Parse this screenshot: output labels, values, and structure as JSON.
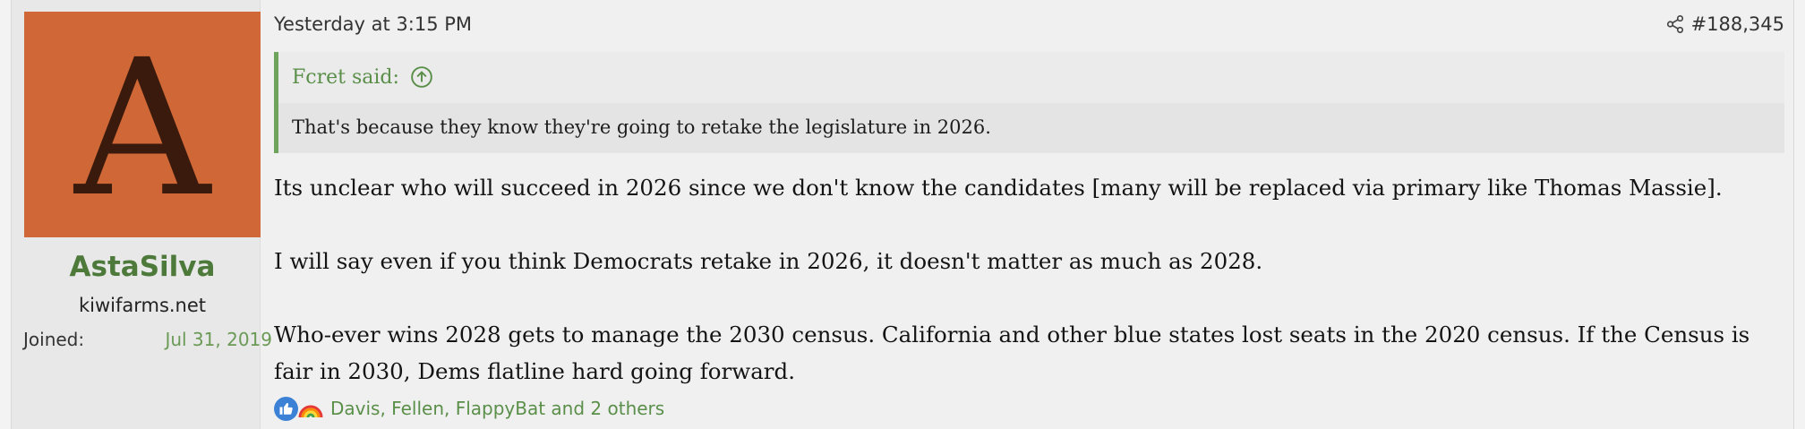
{
  "user": {
    "avatar_letter": "A",
    "avatar_color": "#cf6836",
    "username": "AstaSilva",
    "title": "kiwifarms.net",
    "joined_label": "Joined:",
    "joined_value": "Jul 31, 2019"
  },
  "post": {
    "timestamp": "Yesterday at 3:15 PM",
    "share_icon": "share-icon",
    "number": "#188,345",
    "quote": {
      "author_line": "Fcret said:",
      "jump_icon": "arrow-up-circle-icon",
      "text": "That's because they know they're going to retake the legislature in 2026."
    },
    "message": [
      "Its unclear who will succeed in 2026 since we don't know the candidates [many will be replaced via primary like Thomas Massie].",
      "I will say even if you think Democrats retake in 2026, it doesn't matter as much as 2028.",
      "Who-ever wins 2028 gets to manage the 2030 census. California and other blue states lost seats in the 2020 census. If the Census is fair in 2030, Dems flatline hard going forward."
    ],
    "reactions": {
      "icons": [
        "thumbs-up-icon",
        "rainbow-icon"
      ],
      "users_text": "Davis, Fellen, FlappyBat and 2 others"
    }
  },
  "colors": {
    "accent_green": "#5a8f49",
    "username_green": "#4d7a3b",
    "quote_border": "#6da35a"
  }
}
